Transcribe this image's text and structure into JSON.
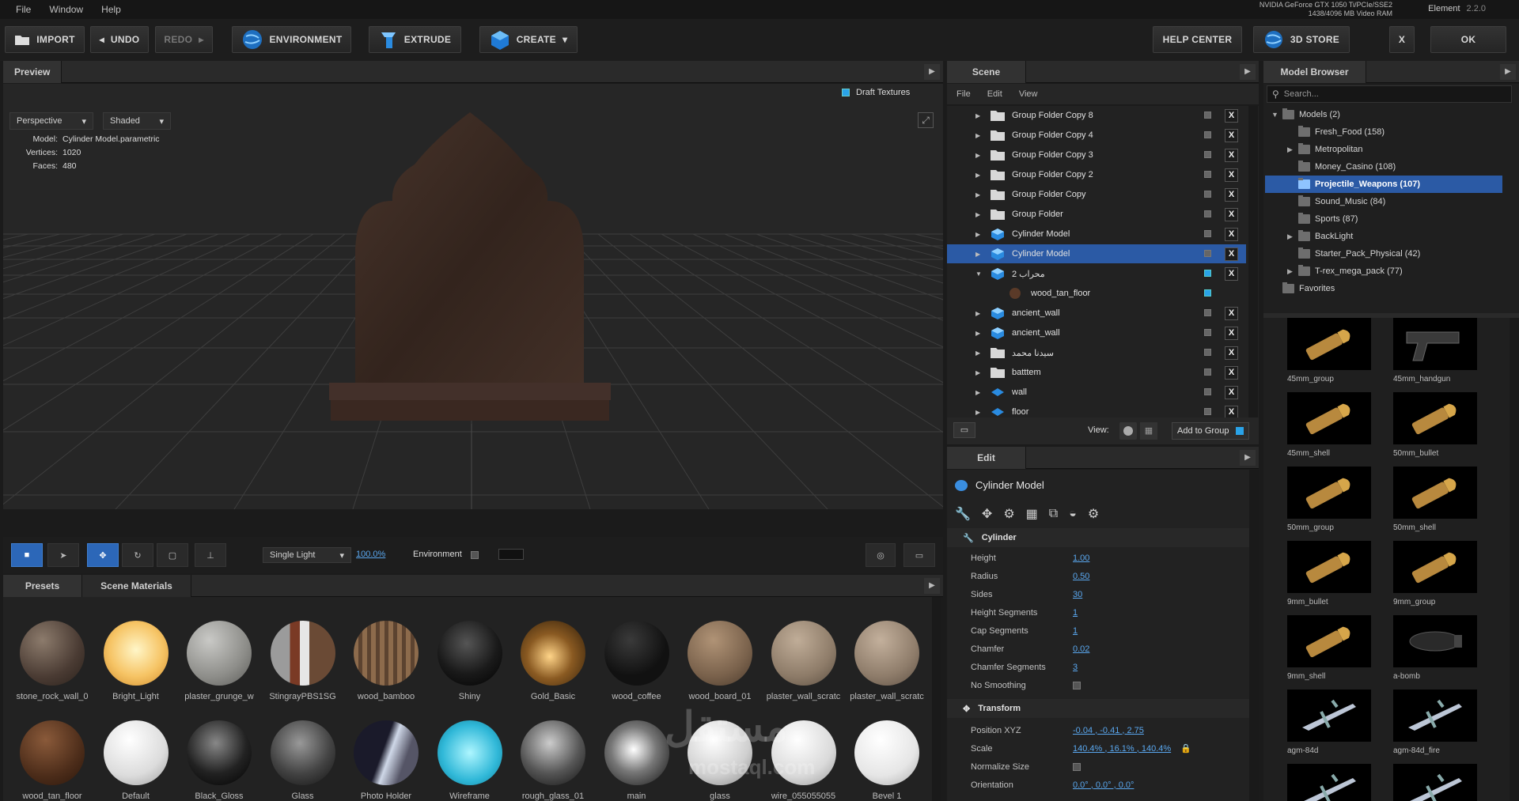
{
  "menu": [
    "File",
    "Window",
    "Help"
  ],
  "gpu": {
    "line1": "NVIDIA GeForce GTX 1050 Ti/PCIe/SSE2",
    "line2": "1438/4096 MB Video RAM"
  },
  "product": {
    "name": "Element",
    "version": "2.2.0"
  },
  "toolbar": {
    "import": "IMPORT",
    "undo": "UNDO",
    "redo": "REDO",
    "environment": "ENVIRONMENT",
    "extrude": "EXTRUDE",
    "create": "CREATE",
    "help": "HELP CENTER",
    "store": "3D STORE",
    "close": "X",
    "ok": "OK"
  },
  "preview": {
    "tab": "Preview",
    "draft": "Draft Textures",
    "camera": "Perspective",
    "shading": "Shaded",
    "stats": {
      "model_k": "Model:",
      "model_v": "Cylinder Model.parametric",
      "vert_k": "Vertices:",
      "vert_v": "1020",
      "face_k": "Faces:",
      "face_v": "480"
    }
  },
  "viewbar": {
    "light": "Single Light",
    "pct": "100.0%",
    "env": "Environment"
  },
  "materials": {
    "tabs": [
      "Presets",
      "Scene Materials"
    ],
    "row1": [
      "stone_rock_wall_0",
      "Bright_Light",
      "plaster_grunge_w",
      "StingrayPBS1SG",
      "wood_bamboo",
      "Shiny",
      "Gold_Basic",
      "wood_coffee",
      "wood_board_01",
      "plaster_wall_scratc",
      "plaster_wall_scratc"
    ],
    "row2": [
      "wood_tan_floor",
      "Default",
      "Black_Gloss",
      "Glass",
      "Photo Holder",
      "Wireframe",
      "rough_glass_01",
      "main",
      "glass",
      "wire_055055055",
      "Bevel 1"
    ]
  },
  "scene": {
    "tab": "Scene",
    "menu": [
      "File",
      "Edit",
      "View"
    ],
    "rows": [
      {
        "name": "Group Folder Copy 8",
        "type": "folder"
      },
      {
        "name": "Group Folder Copy 4",
        "type": "folder"
      },
      {
        "name": "Group Folder Copy 3",
        "type": "folder"
      },
      {
        "name": "Group Folder Copy 2",
        "type": "folder"
      },
      {
        "name": "Group Folder Copy",
        "type": "folder"
      },
      {
        "name": "Group Folder",
        "type": "folder"
      },
      {
        "name": "Cylinder Model",
        "type": "model"
      },
      {
        "name": "Cylinder Model",
        "type": "model"
      },
      {
        "name": "محراب 2",
        "type": "model"
      },
      {
        "name": "wood_tan_floor",
        "type": "material"
      },
      {
        "name": "ancient_wall",
        "type": "model"
      },
      {
        "name": "ancient_wall",
        "type": "model"
      },
      {
        "name": "سيدنا محمد",
        "type": "folder"
      },
      {
        "name": "batttem",
        "type": "folder"
      },
      {
        "name": "wall",
        "type": "plane"
      },
      {
        "name": "floor",
        "type": "plane"
      }
    ],
    "view_label": "View:",
    "add_group": "Add to Group"
  },
  "edit": {
    "tab": "Edit",
    "title": "Cylinder Model",
    "section1": "Cylinder",
    "props": [
      {
        "k": "Height",
        "v": "1.00"
      },
      {
        "k": "Radius",
        "v": "0.50"
      },
      {
        "k": "Sides",
        "v": "30"
      },
      {
        "k": "Height Segments",
        "v": "1"
      },
      {
        "k": "Cap Segments",
        "v": "1"
      },
      {
        "k": "Chamfer",
        "v": "0.02"
      },
      {
        "k": "Chamfer Segments",
        "v": "3"
      },
      {
        "k": "No Smoothing",
        "v": ""
      }
    ],
    "section2": "Transform",
    "transform": [
      {
        "k": "Position XYZ",
        "v": "-0.04 ,  -0.41 ,  2.75"
      },
      {
        "k": "Scale",
        "v": "140.4% ,  16.1% ,  140.4%"
      },
      {
        "k": "Normalize Size",
        "v": ""
      },
      {
        "k": "Orientation",
        "v": "0.0° ,  0.0° ,  0.0°"
      }
    ]
  },
  "browser": {
    "tab": "Model Browser",
    "search": "Search...",
    "tree": [
      {
        "label": "Models (2)",
        "indent": 0,
        "arrow": "▼"
      },
      {
        "label": "Fresh_Food (158)",
        "indent": 1,
        "arrow": ""
      },
      {
        "label": "Metropolitan",
        "indent": 1,
        "arrow": "▶"
      },
      {
        "label": "Money_Casino (108)",
        "indent": 1,
        "arrow": ""
      },
      {
        "label": "Projectile_Weapons (107)",
        "indent": 1,
        "arrow": "",
        "sel": true
      },
      {
        "label": "Sound_Music (84)",
        "indent": 1,
        "arrow": ""
      },
      {
        "label": "Sports (87)",
        "indent": 1,
        "arrow": ""
      },
      {
        "label": "BackLight",
        "indent": 1,
        "arrow": "▶"
      },
      {
        "label": "Starter_Pack_Physical (42)",
        "indent": 1,
        "arrow": ""
      },
      {
        "label": "T-rex_mega_pack (77)",
        "indent": 1,
        "arrow": "▶"
      },
      {
        "label": "Favorites",
        "indent": 0,
        "arrow": ""
      }
    ],
    "thumbs": [
      "45mm_group",
      "45mm_handgun",
      "45mm_shell",
      "50mm_bullet",
      "50mm_group",
      "50mm_shell",
      "9mm_bullet",
      "9mm_group",
      "9mm_shell",
      "a-bomb",
      "agm-84d",
      "agm-84d_fire",
      "",
      ""
    ]
  },
  "watermark": {
    "line1": "مستقل",
    "line2": "mostaql.com"
  },
  "colors": {
    "accent": "#2b5aa5",
    "link": "#5aa8f0",
    "bg": "#1b1b1b"
  }
}
